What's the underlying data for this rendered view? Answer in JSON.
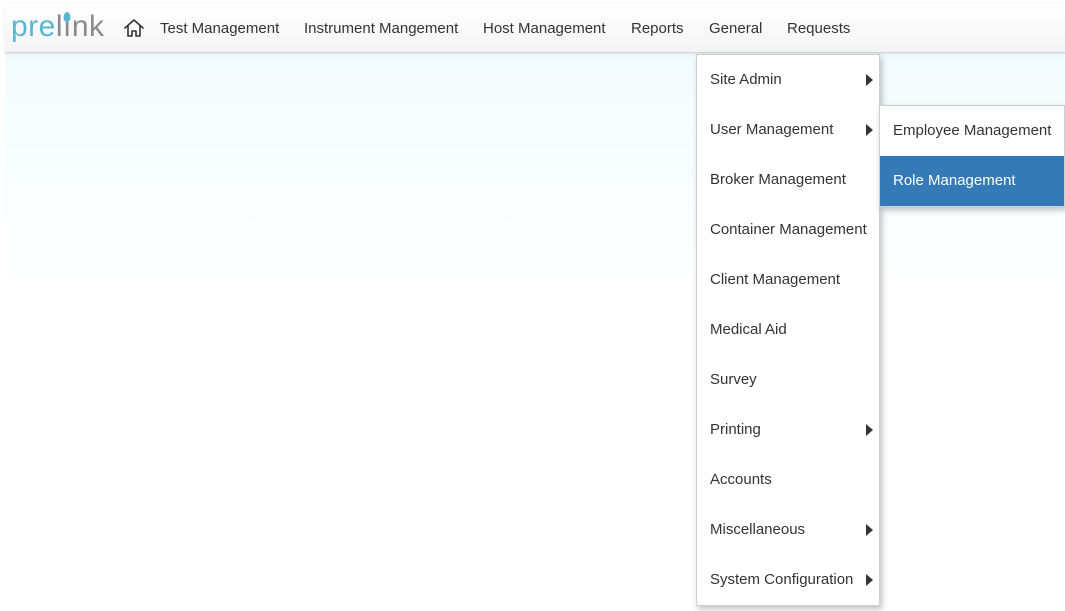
{
  "logo": {
    "part1": "pre",
    "part2a": "l",
    "part2b": "ı",
    "part2c": "nk"
  },
  "navbar": {
    "home_icon": "home-icon",
    "items": [
      {
        "label": "Test Management"
      },
      {
        "label": "Instrument Mangement"
      },
      {
        "label": "Host Management"
      },
      {
        "label": "Reports"
      },
      {
        "label": "General"
      },
      {
        "label": "Requests"
      }
    ]
  },
  "general_menu": {
    "items": [
      {
        "label": "Site Admin",
        "has_submenu": true
      },
      {
        "label": "User Management",
        "has_submenu": true
      },
      {
        "label": "Broker Management",
        "has_submenu": false
      },
      {
        "label": "Container Management",
        "has_submenu": false
      },
      {
        "label": "Client Management",
        "has_submenu": false
      },
      {
        "label": "Medical Aid",
        "has_submenu": false
      },
      {
        "label": "Survey",
        "has_submenu": false
      },
      {
        "label": "Printing",
        "has_submenu": true
      },
      {
        "label": "Accounts",
        "has_submenu": false
      },
      {
        "label": "Miscellaneous",
        "has_submenu": true
      },
      {
        "label": "System Configuration",
        "has_submenu": true
      }
    ]
  },
  "user_management_submenu": {
    "items": [
      {
        "label": "Employee Management",
        "active": false
      },
      {
        "label": "Role Management",
        "active": true
      }
    ]
  },
  "colors": {
    "brand_blue": "#5ab7d3",
    "brand_gray": "#8a8a8a",
    "active_item_bg": "#337ab7",
    "text": "#333333"
  }
}
